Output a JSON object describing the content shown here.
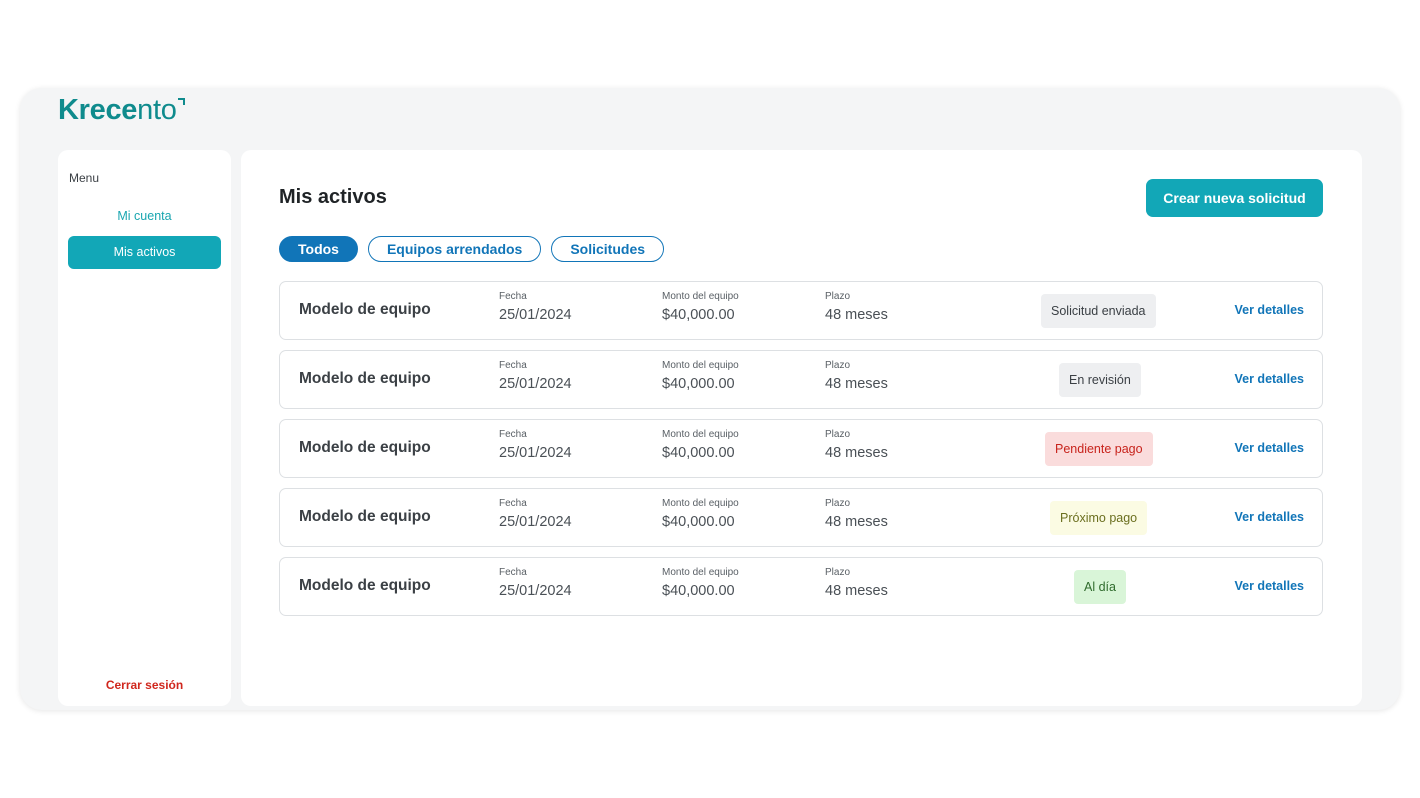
{
  "brand": {
    "name_bold": "Krece",
    "name_light": "nto"
  },
  "sidebar": {
    "heading": "Menu",
    "items": [
      {
        "label": "Mi cuenta"
      },
      {
        "label": "Mis activos"
      }
    ],
    "logout_label": "Cerrar sesión"
  },
  "main": {
    "title": "Mis activos",
    "create_button": "Crear nueva solicitud",
    "tabs": [
      {
        "label": "Todos",
        "active": true
      },
      {
        "label": "Equipos arrendados",
        "active": false
      },
      {
        "label": "Solicitudes",
        "active": false
      }
    ],
    "rows": [
      {
        "title": "Modelo de equipo",
        "date_label": "Fecha",
        "date": "25/01/2024",
        "amount_label": "Monto del equipo",
        "amount": "$40,000.00",
        "term_label": "Plazo",
        "term": "48 meses",
        "status": "Solicitud enviada",
        "status_bg": "#eeeff1",
        "status_fg": "#3a3f44",
        "link": "Ver detalles"
      },
      {
        "title": "Modelo de equipo",
        "date_label": "Fecha",
        "date": "25/01/2024",
        "amount_label": "Monto del equipo",
        "amount": "$40,000.00",
        "term_label": "Plazo",
        "term": "48 meses",
        "status": "En revisión",
        "status_bg": "#eeeff1",
        "status_fg": "#3a3f44",
        "link": "Ver detalles"
      },
      {
        "title": "Modelo de equipo",
        "date_label": "Fecha",
        "date": "25/01/2024",
        "amount_label": "Monto del equipo",
        "amount": "$40,000.00",
        "term_label": "Plazo",
        "term": "48 meses",
        "status": "Pendiente pago",
        "status_bg": "#fadcdc",
        "status_fg": "#c8231c",
        "link": "Ver detalles"
      },
      {
        "title": "Modelo de equipo",
        "date_label": "Fecha",
        "date": "25/01/2024",
        "amount_label": "Monto del equipo",
        "amount": "$40,000.00",
        "term_label": "Plazo",
        "term": "48 meses",
        "status": "Próximo pago",
        "status_bg": "#fbfbe3",
        "status_fg": "#6b6f1f",
        "link": "Ver detalles"
      },
      {
        "title": "Modelo de equipo",
        "date_label": "Fecha",
        "date": "25/01/2024",
        "amount_label": "Monto del equipo",
        "amount": "$40,000.00",
        "term_label": "Plazo",
        "term": "48 meses",
        "status": "Al día",
        "status_bg": "#d9f5d8",
        "status_fg": "#2f6b2c",
        "link": "Ver detalles"
      }
    ]
  },
  "colors": {
    "accent": "#12a7b7",
    "link": "#1175b8",
    "danger": "#d0271d",
    "brand": "#0f8b8d"
  }
}
